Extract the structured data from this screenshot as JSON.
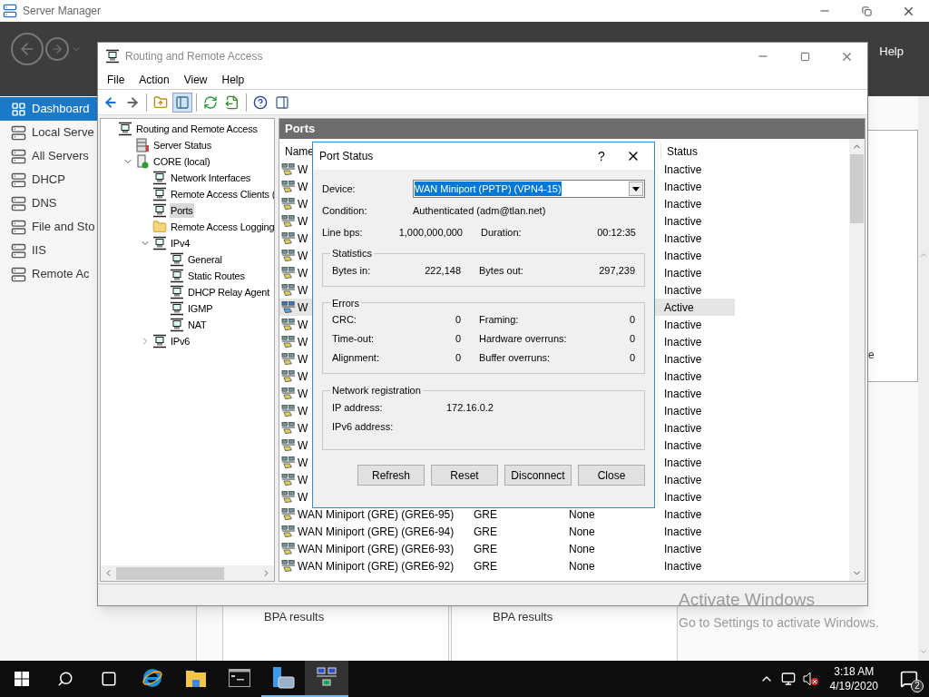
{
  "server_manager": {
    "title": "Server Manager",
    "help": "Help",
    "sidebar": [
      {
        "label": "Dashboard",
        "kind": "dashboard",
        "selected": true
      },
      {
        "label": "Local Serve",
        "kind": "local",
        "selected": false
      },
      {
        "label": "All Servers",
        "kind": "all",
        "selected": false
      },
      {
        "label": "DHCP",
        "kind": "dhcp",
        "selected": false
      },
      {
        "label": "DNS",
        "kind": "dns",
        "selected": false
      },
      {
        "label": "File and Sto",
        "kind": "file",
        "selected": false
      },
      {
        "label": "IIS",
        "kind": "iis",
        "selected": false
      },
      {
        "label": "Remote Ac",
        "kind": "remote",
        "selected": false
      }
    ],
    "tile_fragment": "e",
    "tiles": [
      {
        "label": "BPA results"
      },
      {
        "label": "BPA results"
      }
    ]
  },
  "rras": {
    "title": "Routing and Remote Access",
    "menu": [
      "File",
      "Action",
      "View",
      "Help"
    ],
    "toolbar": [
      {
        "kind": "back",
        "pressed": false
      },
      {
        "kind": "forward",
        "pressed": false
      },
      {
        "kind": "sep"
      },
      {
        "kind": "up",
        "pressed": false
      },
      {
        "kind": "tree",
        "pressed": true
      },
      {
        "kind": "sep"
      },
      {
        "kind": "refresh",
        "pressed": false
      },
      {
        "kind": "export",
        "pressed": false
      },
      {
        "kind": "sep"
      },
      {
        "kind": "help",
        "pressed": false
      },
      {
        "kind": "pane",
        "pressed": false
      }
    ],
    "tree": [
      {
        "label": "Routing and Remote Access",
        "kind": "node",
        "selected": false,
        "children": [
          {
            "label": "Server Status",
            "kind": "servers",
            "selected": false
          },
          {
            "label": "CORE (local)",
            "kind": "server",
            "selected": false,
            "expanded": true,
            "children": [
              {
                "label": "Network Interfaces",
                "kind": "node",
                "selected": false
              },
              {
                "label": "Remote Access Clients (",
                "kind": "node",
                "selected": false
              },
              {
                "label": "Ports",
                "kind": "node",
                "selected": true
              },
              {
                "label": "Remote Access Logging",
                "kind": "folder",
                "selected": false
              },
              {
                "label": "IPv4",
                "kind": "node",
                "selected": false,
                "expanded": true,
                "children": [
                  {
                    "label": "General",
                    "kind": "node",
                    "selected": false
                  },
                  {
                    "label": "Static Routes",
                    "kind": "node",
                    "selected": false
                  },
                  {
                    "label": "DHCP Relay Agent",
                    "kind": "node",
                    "selected": false
                  },
                  {
                    "label": "IGMP",
                    "kind": "node",
                    "selected": false
                  },
                  {
                    "label": "NAT",
                    "kind": "node",
                    "selected": false
                  }
                ]
              },
              {
                "label": "IPv6",
                "kind": "node",
                "selected": false,
                "expanded": false
              }
            ]
          }
        ]
      }
    ],
    "pane_title": "Ports",
    "columns": [
      "Name",
      "Status"
    ],
    "ports": [
      {
        "name": "W",
        "status": "Inactive",
        "selected": false
      },
      {
        "name": "W",
        "status": "Inactive",
        "selected": false
      },
      {
        "name": "W",
        "status": "Inactive",
        "selected": false
      },
      {
        "name": "W",
        "status": "Inactive",
        "selected": false
      },
      {
        "name": "W",
        "status": "Inactive",
        "selected": false
      },
      {
        "name": "W",
        "status": "Inactive",
        "selected": false
      },
      {
        "name": "W",
        "status": "Inactive",
        "selected": false
      },
      {
        "name": "W",
        "status": "Inactive",
        "selected": false
      },
      {
        "name": "W",
        "status": "Active",
        "selected": true
      },
      {
        "name": "W",
        "status": "Inactive",
        "selected": false
      },
      {
        "name": "W",
        "status": "Inactive",
        "selected": false
      },
      {
        "name": "W",
        "status": "Inactive",
        "selected": false
      },
      {
        "name": "W",
        "status": "Inactive",
        "selected": false
      },
      {
        "name": "W",
        "status": "Inactive",
        "selected": false
      },
      {
        "name": "W",
        "status": "Inactive",
        "selected": false
      },
      {
        "name": "W",
        "status": "Inactive",
        "selected": false
      },
      {
        "name": "W",
        "status": "Inactive",
        "selected": false
      },
      {
        "name": "W",
        "status": "Inactive",
        "selected": false
      },
      {
        "name": "W",
        "status": "Inactive",
        "selected": false
      },
      {
        "name": "W",
        "status": "Inactive",
        "selected": false
      },
      {
        "name": "WAN Miniport (GRE) (GRE6-95)",
        "type": "GRE",
        "device": "None",
        "status": "Inactive",
        "selected": false
      },
      {
        "name": "WAN Miniport (GRE) (GRE6-94)",
        "type": "GRE",
        "device": "None",
        "status": "Inactive",
        "selected": false
      },
      {
        "name": "WAN Miniport (GRE) (GRE6-93)",
        "type": "GRE",
        "device": "None",
        "status": "Inactive",
        "selected": false
      },
      {
        "name": "WAN Miniport (GRE) (GRE6-92)",
        "type": "GRE",
        "device": "None",
        "status": "Inactive",
        "selected": false
      }
    ]
  },
  "dialog": {
    "title": "Port Status",
    "help": "?",
    "device_label": "Device:",
    "device": "WAN Miniport (PPTP) (VPN4-15)",
    "condition_label": "Condition:",
    "condition": "Authenticated (adm@tlan.net)",
    "line_label": "Line bps:",
    "line": "1,000,000,000",
    "duration_label": "Duration:",
    "duration": "00:12:35",
    "groups": [
      {
        "title": "Statistics",
        "rows": [
          [
            "Bytes in:",
            "222,148",
            "Bytes out:",
            "297,239"
          ]
        ]
      },
      {
        "title": "Errors",
        "rows": [
          [
            "CRC:",
            "0",
            "Framing:",
            "0"
          ],
          [
            "Time-out:",
            "0",
            "Hardware overruns:",
            "0"
          ],
          [
            "Alignment:",
            "0",
            "Buffer overruns:",
            "0"
          ]
        ]
      },
      {
        "title": "Network registration",
        "rows": [
          [
            "IP address:",
            "172.16.0.2"
          ],
          [
            "IPv6 address:"
          ]
        ]
      }
    ],
    "buttons": [
      "Refresh",
      "Reset",
      "Disconnect",
      "Close"
    ]
  },
  "activation": {
    "title": "Activate Windows",
    "subtitle": "Go to Settings to activate Windows."
  },
  "taskbar": {
    "apps": [
      {
        "kind": "ie",
        "running": false,
        "selected": false
      },
      {
        "kind": "explorer",
        "running": false,
        "selected": false
      },
      {
        "kind": "cmd",
        "running": false,
        "selected": false
      },
      {
        "kind": "servermanager",
        "running": true,
        "selected": false
      },
      {
        "kind": "rras",
        "running": true,
        "selected": true
      }
    ],
    "time": "3:18 AM",
    "date": "4/19/2020",
    "notifications": "2"
  }
}
